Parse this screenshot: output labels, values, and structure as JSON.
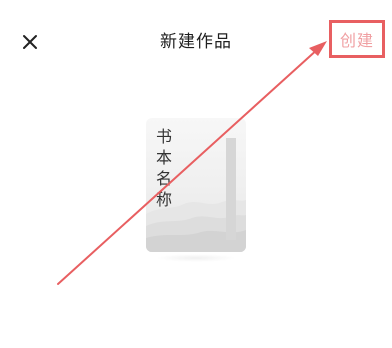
{
  "header": {
    "close_icon": "close-icon",
    "title": "新建作品",
    "create_label": "创建"
  },
  "book_cover": {
    "title": "书本名称"
  },
  "colors": {
    "annotation_red": "#e85f61",
    "create_text": "#f0a0a3",
    "title_text": "#1f1f1f",
    "cover_bg": "#efefef"
  }
}
